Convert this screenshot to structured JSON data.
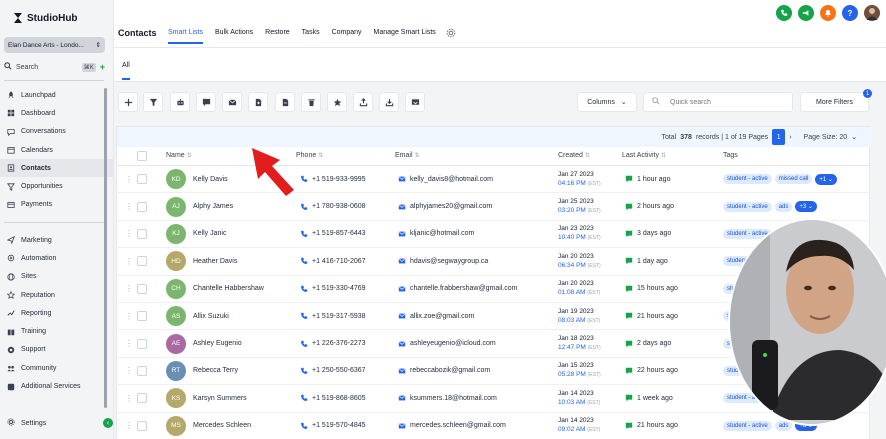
{
  "brand": {
    "name": "StudioHub"
  },
  "account": {
    "name": "Elan Dance Arts - Londo..."
  },
  "sidebar": {
    "search_label": "Search",
    "search_shortcut": "⌘K",
    "items_top": [
      {
        "label": "Launchpad",
        "icon": "rocket-icon"
      },
      {
        "label": "Dashboard",
        "icon": "dashboard-icon"
      },
      {
        "label": "Conversations",
        "icon": "chat-icon"
      },
      {
        "label": "Calendars",
        "icon": "calendar-icon"
      },
      {
        "label": "Contacts",
        "icon": "contacts-icon",
        "active": true
      },
      {
        "label": "Opportunities",
        "icon": "funnel-icon"
      },
      {
        "label": "Payments",
        "icon": "payments-icon"
      }
    ],
    "items_bottom": [
      {
        "label": "Marketing",
        "icon": "send-icon"
      },
      {
        "label": "Automation",
        "icon": "automation-icon"
      },
      {
        "label": "Sites",
        "icon": "globe-icon"
      },
      {
        "label": "Reputation",
        "icon": "star-icon"
      },
      {
        "label": "Reporting",
        "icon": "chart-icon"
      },
      {
        "label": "Training",
        "icon": "book-icon"
      },
      {
        "label": "Support",
        "icon": "support-icon"
      },
      {
        "label": "Community",
        "icon": "community-icon"
      },
      {
        "label": "Additional Services",
        "icon": "services-icon"
      }
    ],
    "settings_label": "Settings"
  },
  "header": {
    "title": "Contacts",
    "tabs": [
      "Smart Lists",
      "Bulk Actions",
      "Restore",
      "Tasks",
      "Company",
      "Manage Smart Lists"
    ]
  },
  "subtab": {
    "label": "All"
  },
  "toolbar": {
    "columns_label": "Columns",
    "search_placeholder": "Quick search",
    "more_filters_label": "More Filters",
    "more_filters_count": "1"
  },
  "pager": {
    "total_prefix": "Total",
    "total_records": "378",
    "total_suffix": "records | 1 of 19 Pages",
    "current_page": "1",
    "page_size_label": "Page Size: 20"
  },
  "table": {
    "columns": [
      "Name",
      "Phone",
      "Email",
      "Created",
      "Last Activity",
      "Tags"
    ],
    "rows": [
      {
        "initials": "KD",
        "color": "#7cb66e",
        "name": "Kelly Davis",
        "phone": "+1 519-933-9995",
        "email": "kelly_davis8@hotmail.com",
        "date": "Jan 27 2023",
        "time": "04:16 PM",
        "tz": "(EST)",
        "activity": "1 hour ago",
        "tags": [
          "student - active",
          "missed call"
        ],
        "more": "+1"
      },
      {
        "initials": "AJ",
        "color": "#7cb66e",
        "name": "Alphy James",
        "phone": "+1 780-938-0608",
        "email": "alphyjames20@gmail.com",
        "date": "Jan 25 2023",
        "time": "03:20 PM",
        "tz": "(EST)",
        "activity": "2 hours ago",
        "tags": [
          "student - active",
          "ads"
        ],
        "more": "+3"
      },
      {
        "initials": "KJ",
        "color": "#7cb66e",
        "name": "Kelly Janic",
        "phone": "+1 519-857-6443",
        "email": "kljanic@hotmail.com",
        "date": "Jan 23 2023",
        "time": "10:40 PM",
        "tz": "(EST)",
        "activity": "3 days ago",
        "tags": [
          "student - active"
        ],
        "more": ""
      },
      {
        "initials": "HD",
        "color": "#b4a86a",
        "name": "Heather Davis",
        "phone": "+1 416-710-2067",
        "email": "hdavis@segwaygroup.ca",
        "date": "Jan 20 2023",
        "time": "06:34 PM",
        "tz": "(EST)",
        "activity": "1 day ago",
        "tags": [
          "student - active"
        ],
        "more": ""
      },
      {
        "initials": "CH",
        "color": "#7cb66e",
        "name": "Chantelle Habbershaw",
        "phone": "+1 519-330-4769",
        "email": "chantelle.frabbershaw@gmail.com",
        "date": "Jan 20 2023",
        "time": "01:08 AM",
        "tz": "(EST)",
        "activity": "15 hours ago",
        "tags": [
          "student - active"
        ],
        "more": ""
      },
      {
        "initials": "AS",
        "color": "#7cb66e",
        "name": "Allix Suzuki",
        "phone": "+1 519-317-5938",
        "email": "allix.zoe@gmail.com",
        "date": "Jan 19 2023",
        "time": "08:03 AM",
        "tz": "(EST)",
        "activity": "21 hours ago",
        "tags": [
          "student - active"
        ],
        "more": ""
      },
      {
        "initials": "AE",
        "color": "#a86aa0",
        "name": "Ashley Eugenio",
        "phone": "+1 226-376-2273",
        "email": "ashleyeugenio@icloud.com",
        "date": "Jan 18 2023",
        "time": "12:47 PM",
        "tz": "(EST)",
        "activity": "2 days ago",
        "tags": [
          "student - active"
        ],
        "more": ""
      },
      {
        "initials": "RT",
        "color": "#6a8fb4",
        "name": "Rebecca Terry",
        "phone": "+1 250-550-6367",
        "email": "rebeccabozik@gmail.com",
        "date": "Jan 15 2023",
        "time": "05:28 PM",
        "tz": "(EST)",
        "activity": "22 hours ago",
        "tags": [
          "student - active"
        ],
        "more": ""
      },
      {
        "initials": "KS",
        "color": "#b4a86a",
        "name": "Karsyn Summers",
        "phone": "+1 519-868-8605",
        "email": "ksummers.18@hotmail.com",
        "date": "Jan 14 2023",
        "time": "10:03 AM",
        "tz": "(EST)",
        "activity": "1 week ago",
        "tags": [
          "student - active"
        ],
        "more": ""
      },
      {
        "initials": "MS",
        "color": "#b4a86a",
        "name": "Mercedes Schleen",
        "phone": "+1 519-570-4845",
        "email": "mercedes.schleen@gmail.com",
        "date": "Jan 14 2023",
        "time": "09:02 AM",
        "tz": "(EST)",
        "activity": "21 hours ago",
        "tags": [
          "student - active",
          "ads"
        ],
        "more": "+3"
      }
    ]
  },
  "colors": {
    "accent": "#2563eb",
    "brand_green": "#16a34a",
    "annotation_red": "#e11d1d"
  }
}
